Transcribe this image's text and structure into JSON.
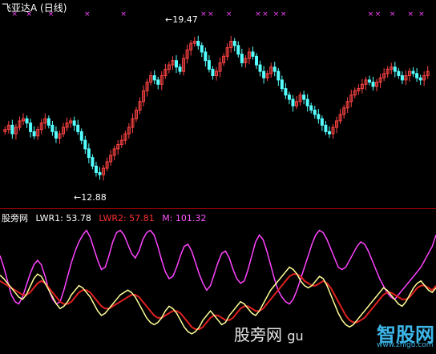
{
  "main": {
    "title": "飞亚达A",
    "period": "(日线)",
    "high_label": "19.47",
    "low_label": "12.88",
    "high_arrow": "←",
    "low_arrow": "←"
  },
  "indicator": {
    "name": "股旁网",
    "lwr1_label": "LWR1: 53.78",
    "lwr2_label": "LWR2: 57.81",
    "m_label": "M: 101.32"
  },
  "watermark": {
    "text": "股旁网",
    "partial": "gu",
    "logo_text": "智股网",
    "logo_url": "www.zhigu.com"
  },
  "colors": {
    "up": "#ff4444",
    "down": "#55ffff",
    "lwr1": "#ffff99",
    "lwr2": "#e02020",
    "m": "#ff44ff",
    "markers": "#ff44ff"
  },
  "chart_data": [
    {
      "type": "candlestick",
      "title": "飞亚达A (日线)",
      "ylim": [
        12.0,
        20.0
      ],
      "annotations": [
        {
          "label": "19.47",
          "type": "high"
        },
        {
          "label": "12.88",
          "type": "low"
        }
      ],
      "closes": [
        15.1,
        15.3,
        14.9,
        15.2,
        15.5,
        15.6,
        15.4,
        15.0,
        14.8,
        15.1,
        15.4,
        15.6,
        15.3,
        15.0,
        14.7,
        14.9,
        15.2,
        15.4,
        15.5,
        15.3,
        15.0,
        14.6,
        14.2,
        13.8,
        13.4,
        13.1,
        13.0,
        13.3,
        13.6,
        13.9,
        14.2,
        14.4,
        14.6,
        14.9,
        15.2,
        15.6,
        16.0,
        16.4,
        16.9,
        17.3,
        17.6,
        17.4,
        17.2,
        17.6,
        17.9,
        18.1,
        18.3,
        18.0,
        17.8,
        18.4,
        18.8,
        19.1,
        19.2,
        19.0,
        18.7,
        18.3,
        17.9,
        17.6,
        17.8,
        18.2,
        18.5,
        18.9,
        19.2,
        19.0,
        18.6,
        18.2,
        18.4,
        18.7,
        18.5,
        18.1,
        17.8,
        17.5,
        17.7,
        18.0,
        17.8,
        17.4,
        17.0,
        16.7,
        16.5,
        16.2,
        16.4,
        16.7,
        16.5,
        16.2,
        16.0,
        15.8,
        15.6,
        15.3,
        15.0,
        14.9,
        15.2,
        15.5,
        15.8,
        16.1,
        16.4,
        16.7,
        16.9,
        17.0,
        17.2,
        17.4,
        17.3,
        17.1,
        17.3,
        17.5,
        17.7,
        17.9,
        18.0,
        17.8,
        17.6,
        17.4,
        17.6,
        17.8,
        17.7,
        17.5,
        17.4,
        17.6,
        17.8
      ],
      "markers_top": true
    },
    {
      "type": "line",
      "series": [
        {
          "name": "LWR1"
        },
        {
          "name": "LWR2"
        },
        {
          "name": "M"
        }
      ],
      "ylim": [
        0,
        110
      ],
      "lwr1": [
        65,
        62,
        58,
        54,
        50,
        46,
        44,
        48,
        55,
        62,
        66,
        64,
        58,
        52,
        46,
        40,
        36,
        38,
        42,
        48,
        52,
        56,
        54,
        50,
        46,
        40,
        34,
        30,
        32,
        36,
        40,
        44,
        48,
        50,
        52,
        50,
        46,
        40,
        34,
        28,
        24,
        22,
        24,
        28,
        34,
        38,
        36,
        32,
        26,
        20,
        16,
        14,
        16,
        20,
        26,
        30,
        34,
        30,
        26,
        22,
        24,
        30,
        34,
        38,
        42,
        40,
        36,
        32,
        30,
        34,
        40,
        46,
        52,
        56,
        60,
        64,
        68,
        72,
        70,
        66,
        60,
        56,
        54,
        56,
        60,
        64,
        62,
        56,
        48,
        40,
        32,
        26,
        22,
        20,
        22,
        26,
        30,
        34,
        38,
        42,
        46,
        50,
        54,
        52,
        48,
        44,
        40,
        38,
        42,
        48,
        54,
        58,
        60,
        56,
        52,
        50,
        54
      ],
      "lwr2": [
        60,
        58,
        56,
        54,
        52,
        50,
        48,
        48,
        50,
        54,
        58,
        60,
        58,
        54,
        50,
        46,
        42,
        40,
        40,
        42,
        46,
        50,
        52,
        52,
        50,
        46,
        42,
        38,
        36,
        36,
        38,
        40,
        42,
        44,
        46,
        48,
        48,
        46,
        42,
        38,
        34,
        30,
        28,
        28,
        30,
        32,
        34,
        34,
        32,
        28,
        24,
        20,
        18,
        18,
        20,
        24,
        28,
        30,
        30,
        28,
        26,
        26,
        28,
        32,
        36,
        38,
        38,
        36,
        34,
        34,
        36,
        40,
        44,
        48,
        52,
        56,
        60,
        64,
        66,
        66,
        64,
        60,
        58,
        56,
        56,
        58,
        60,
        58,
        54,
        48,
        42,
        36,
        30,
        26,
        24,
        24,
        26,
        28,
        32,
        36,
        40,
        44,
        48,
        50,
        50,
        48,
        46,
        44,
        44,
        46,
        50,
        54,
        56,
        56,
        54,
        52,
        56
      ],
      "m": [
        82,
        72,
        60,
        48,
        42,
        40,
        46,
        56,
        66,
        74,
        78,
        74,
        64,
        52,
        44,
        40,
        42,
        52,
        64,
        76,
        86,
        94,
        100,
        104,
        98,
        88,
        78,
        70,
        72,
        82,
        94,
        102,
        104,
        100,
        92,
        84,
        80,
        86,
        96,
        102,
        104,
        100,
        90,
        78,
        68,
        62,
        64,
        72,
        82,
        90,
        92,
        86,
        76,
        66,
        58,
        52,
        56,
        66,
        76,
        84,
        86,
        80,
        70,
        62,
        58,
        60,
        70,
        82,
        94,
        100,
        96,
        86,
        74,
        62,
        52,
        46,
        42,
        40,
        44,
        52,
        62,
        72,
        82,
        92,
        100,
        104,
        102,
        96,
        88,
        80,
        72,
        70,
        72,
        78,
        84,
        90,
        94,
        92,
        86,
        78,
        70,
        62,
        56,
        50,
        46,
        44,
        48,
        52,
        56,
        60,
        64,
        68,
        72,
        78,
        84,
        90,
        100
      ]
    }
  ]
}
